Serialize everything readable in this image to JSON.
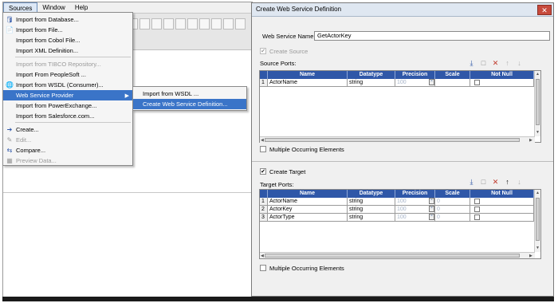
{
  "menubar": {
    "items": [
      "Sources",
      "Window",
      "Help"
    ]
  },
  "sources_menu": {
    "items": [
      {
        "label": "Import from Database...",
        "icon": "database-icon",
        "enabled": true
      },
      {
        "label": "Import from File...",
        "icon": "file-icon",
        "enabled": true
      },
      {
        "label": "Import from Cobol File...",
        "icon": "",
        "enabled": true
      },
      {
        "label": "Import XML Definition...",
        "icon": "",
        "enabled": true
      },
      {
        "label": "Import from TIBCO Repository...",
        "icon": "",
        "enabled": false
      },
      {
        "label": "Import From PeopleSoft ...",
        "icon": "",
        "enabled": true
      },
      {
        "label": "Import from WSDL (Consumer)...",
        "icon": "wsdl-icon",
        "enabled": true
      },
      {
        "label": "Web Service Provider",
        "icon": "",
        "enabled": true,
        "highlighted": true
      },
      {
        "label": "Import from PowerExchange...",
        "icon": "",
        "enabled": true
      },
      {
        "label": "Import from Salesforce.com...",
        "icon": "",
        "enabled": true
      },
      {
        "label": "Create...",
        "icon": "create-arrow-icon",
        "enabled": true
      },
      {
        "label": "Edit...",
        "icon": "edit-icon",
        "enabled": false
      },
      {
        "label": "Compare...",
        "icon": "compare-icon",
        "enabled": true
      },
      {
        "label": "Preview Data...",
        "icon": "preview-icon",
        "enabled": false
      }
    ]
  },
  "sub_menu": {
    "items": [
      {
        "label": "Import from WSDL ..."
      },
      {
        "label": "Create Web Service Definition...",
        "highlighted": true
      }
    ]
  },
  "dialog": {
    "title": "Create Web Service Definition",
    "close_label": "✕",
    "ws_name_label": "Web Service Name:",
    "ws_name_value": "GetActorKey",
    "create_source_label": "Create Source",
    "create_source_checked": true,
    "create_source_enabled": false,
    "source_ports_label": "Source Ports:",
    "create_target_label": "Create Target",
    "create_target_checked": true,
    "target_ports_label": "Target Ports:",
    "multiple_occurring_label": "Multiple Occurring Elements",
    "columns": [
      "Name",
      "Datatype",
      "Precision",
      "Scale",
      "Not Null"
    ],
    "source_rows": [
      {
        "num": "1",
        "name": "ActorName",
        "datatype": "string",
        "precision": "100",
        "scale": ""
      }
    ],
    "target_rows": [
      {
        "num": "1",
        "name": "ActorName",
        "datatype": "string",
        "precision": "100",
        "scale": "0"
      },
      {
        "num": "2",
        "name": "ActorKey",
        "datatype": "string",
        "precision": "100",
        "scale": "0"
      },
      {
        "num": "3",
        "name": "ActorType",
        "datatype": "string",
        "precision": "100",
        "scale": "0"
      }
    ]
  },
  "colors": {
    "menu_highlight": "#3a74c8",
    "grid_header": "#2f57a8",
    "title_bar": "#dfe7f1",
    "close_button": "#c74a3c"
  }
}
